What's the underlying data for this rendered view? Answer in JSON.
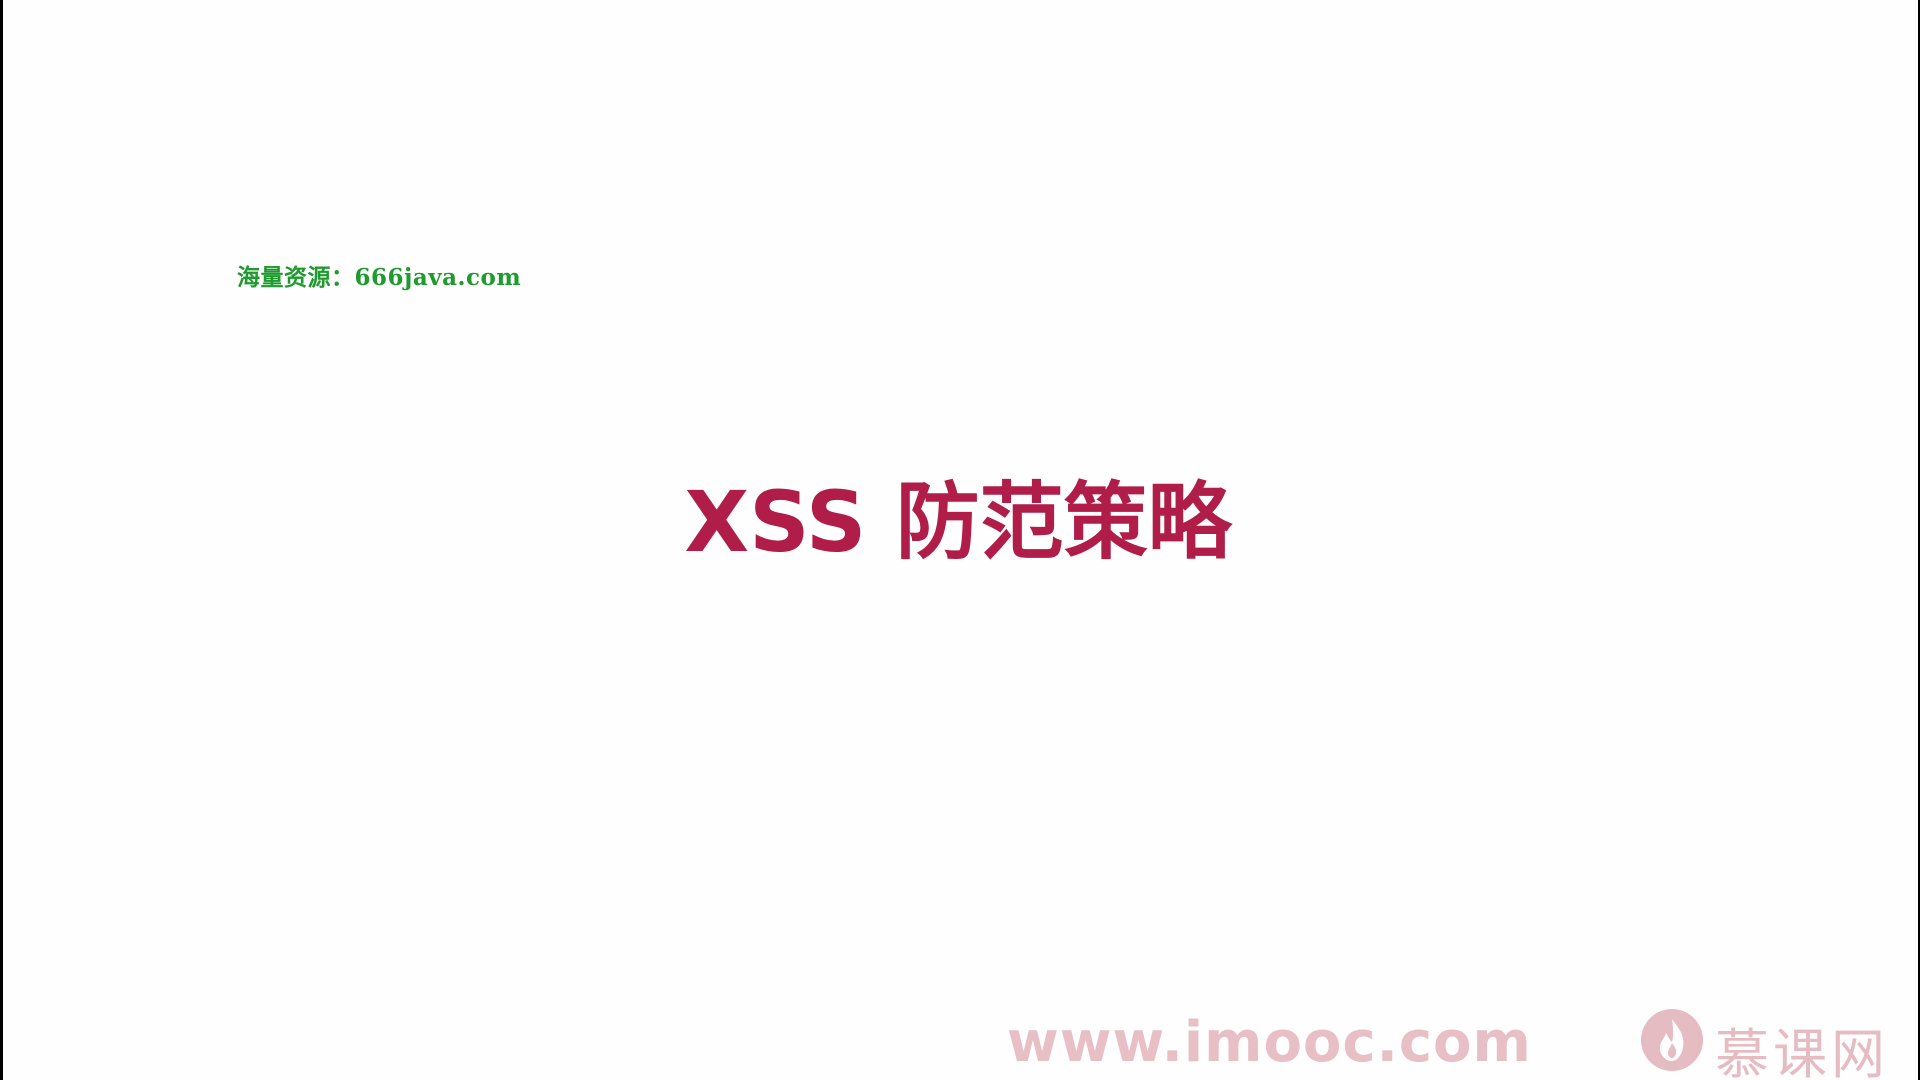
{
  "resource_note": "海量资源：666java.com",
  "slide": {
    "title": "XSS 防范策略"
  },
  "watermark": {
    "url": "www.imooc.com",
    "brand": "慕课网",
    "logo_icon": "imooc-flame-logo-icon",
    "color": "#e6bcc3"
  },
  "colors": {
    "title": "#b01d48",
    "resource_note": "#1f9a2e",
    "background": "#fefefe"
  }
}
